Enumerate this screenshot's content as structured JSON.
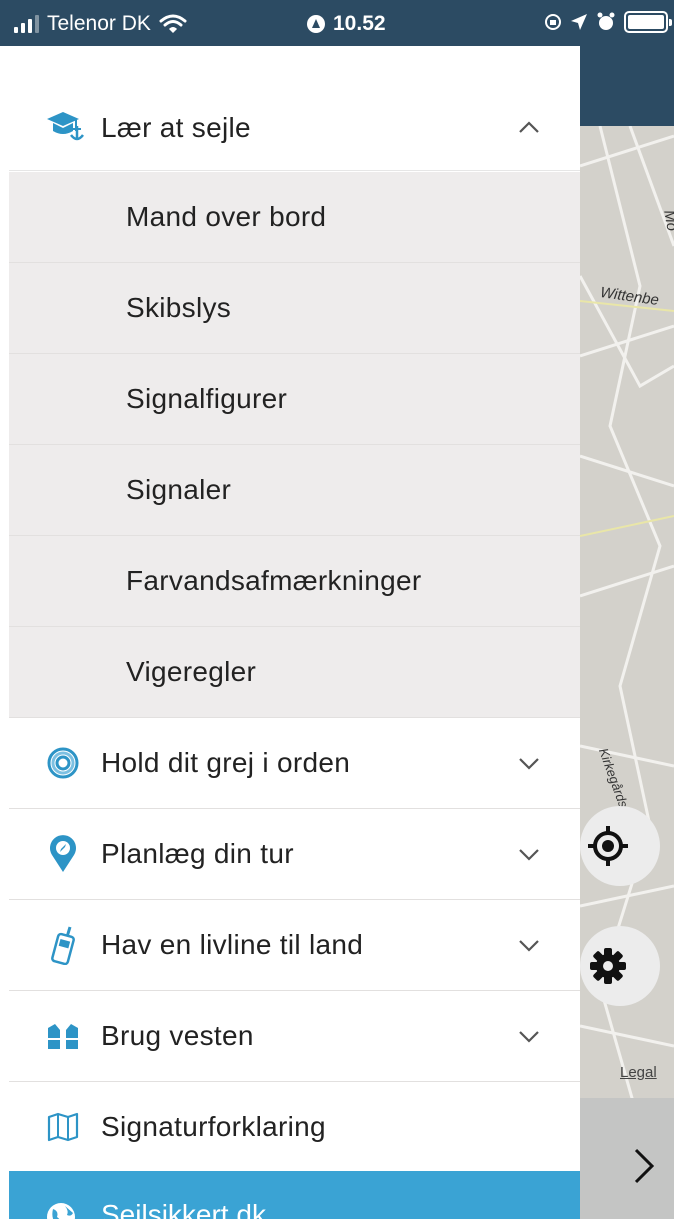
{
  "status_bar": {
    "carrier": "Telenor DK",
    "time": "10.52"
  },
  "drawer": {
    "expanded_section": {
      "label": "Lær at sejle",
      "icon": "graduation-cap-anchor-icon",
      "items": [
        {
          "label": "Mand over bord"
        },
        {
          "label": "Skibslys"
        },
        {
          "label": "Signalfigurer"
        },
        {
          "label": "Signaler"
        },
        {
          "label": "Farvandsafmærkninger"
        },
        {
          "label": "Vigeregler"
        }
      ]
    },
    "sections": [
      {
        "label": "Hold dit grej i orden",
        "icon": "rope-coil-icon"
      },
      {
        "label": "Planlæg din tur",
        "icon": "map-pin-compass-icon"
      },
      {
        "label": "Hav en livline til land",
        "icon": "vhf-radio-icon"
      },
      {
        "label": "Brug vesten",
        "icon": "life-vest-icon"
      }
    ],
    "signature_item": {
      "label": "Signaturforklaring",
      "icon": "map-icon"
    },
    "footer_item": {
      "label": "Sejlsikkert.dk",
      "icon": "globe-icon"
    }
  },
  "map": {
    "street_1": "Wittenbe",
    "street_2": "Kirkegårdsvej",
    "street_3": "Mo",
    "legal": "Legal"
  },
  "colors": {
    "accent": "#3aa3d4",
    "header_bar": "#2c4b63",
    "submenu_bg": "#eeecec"
  }
}
